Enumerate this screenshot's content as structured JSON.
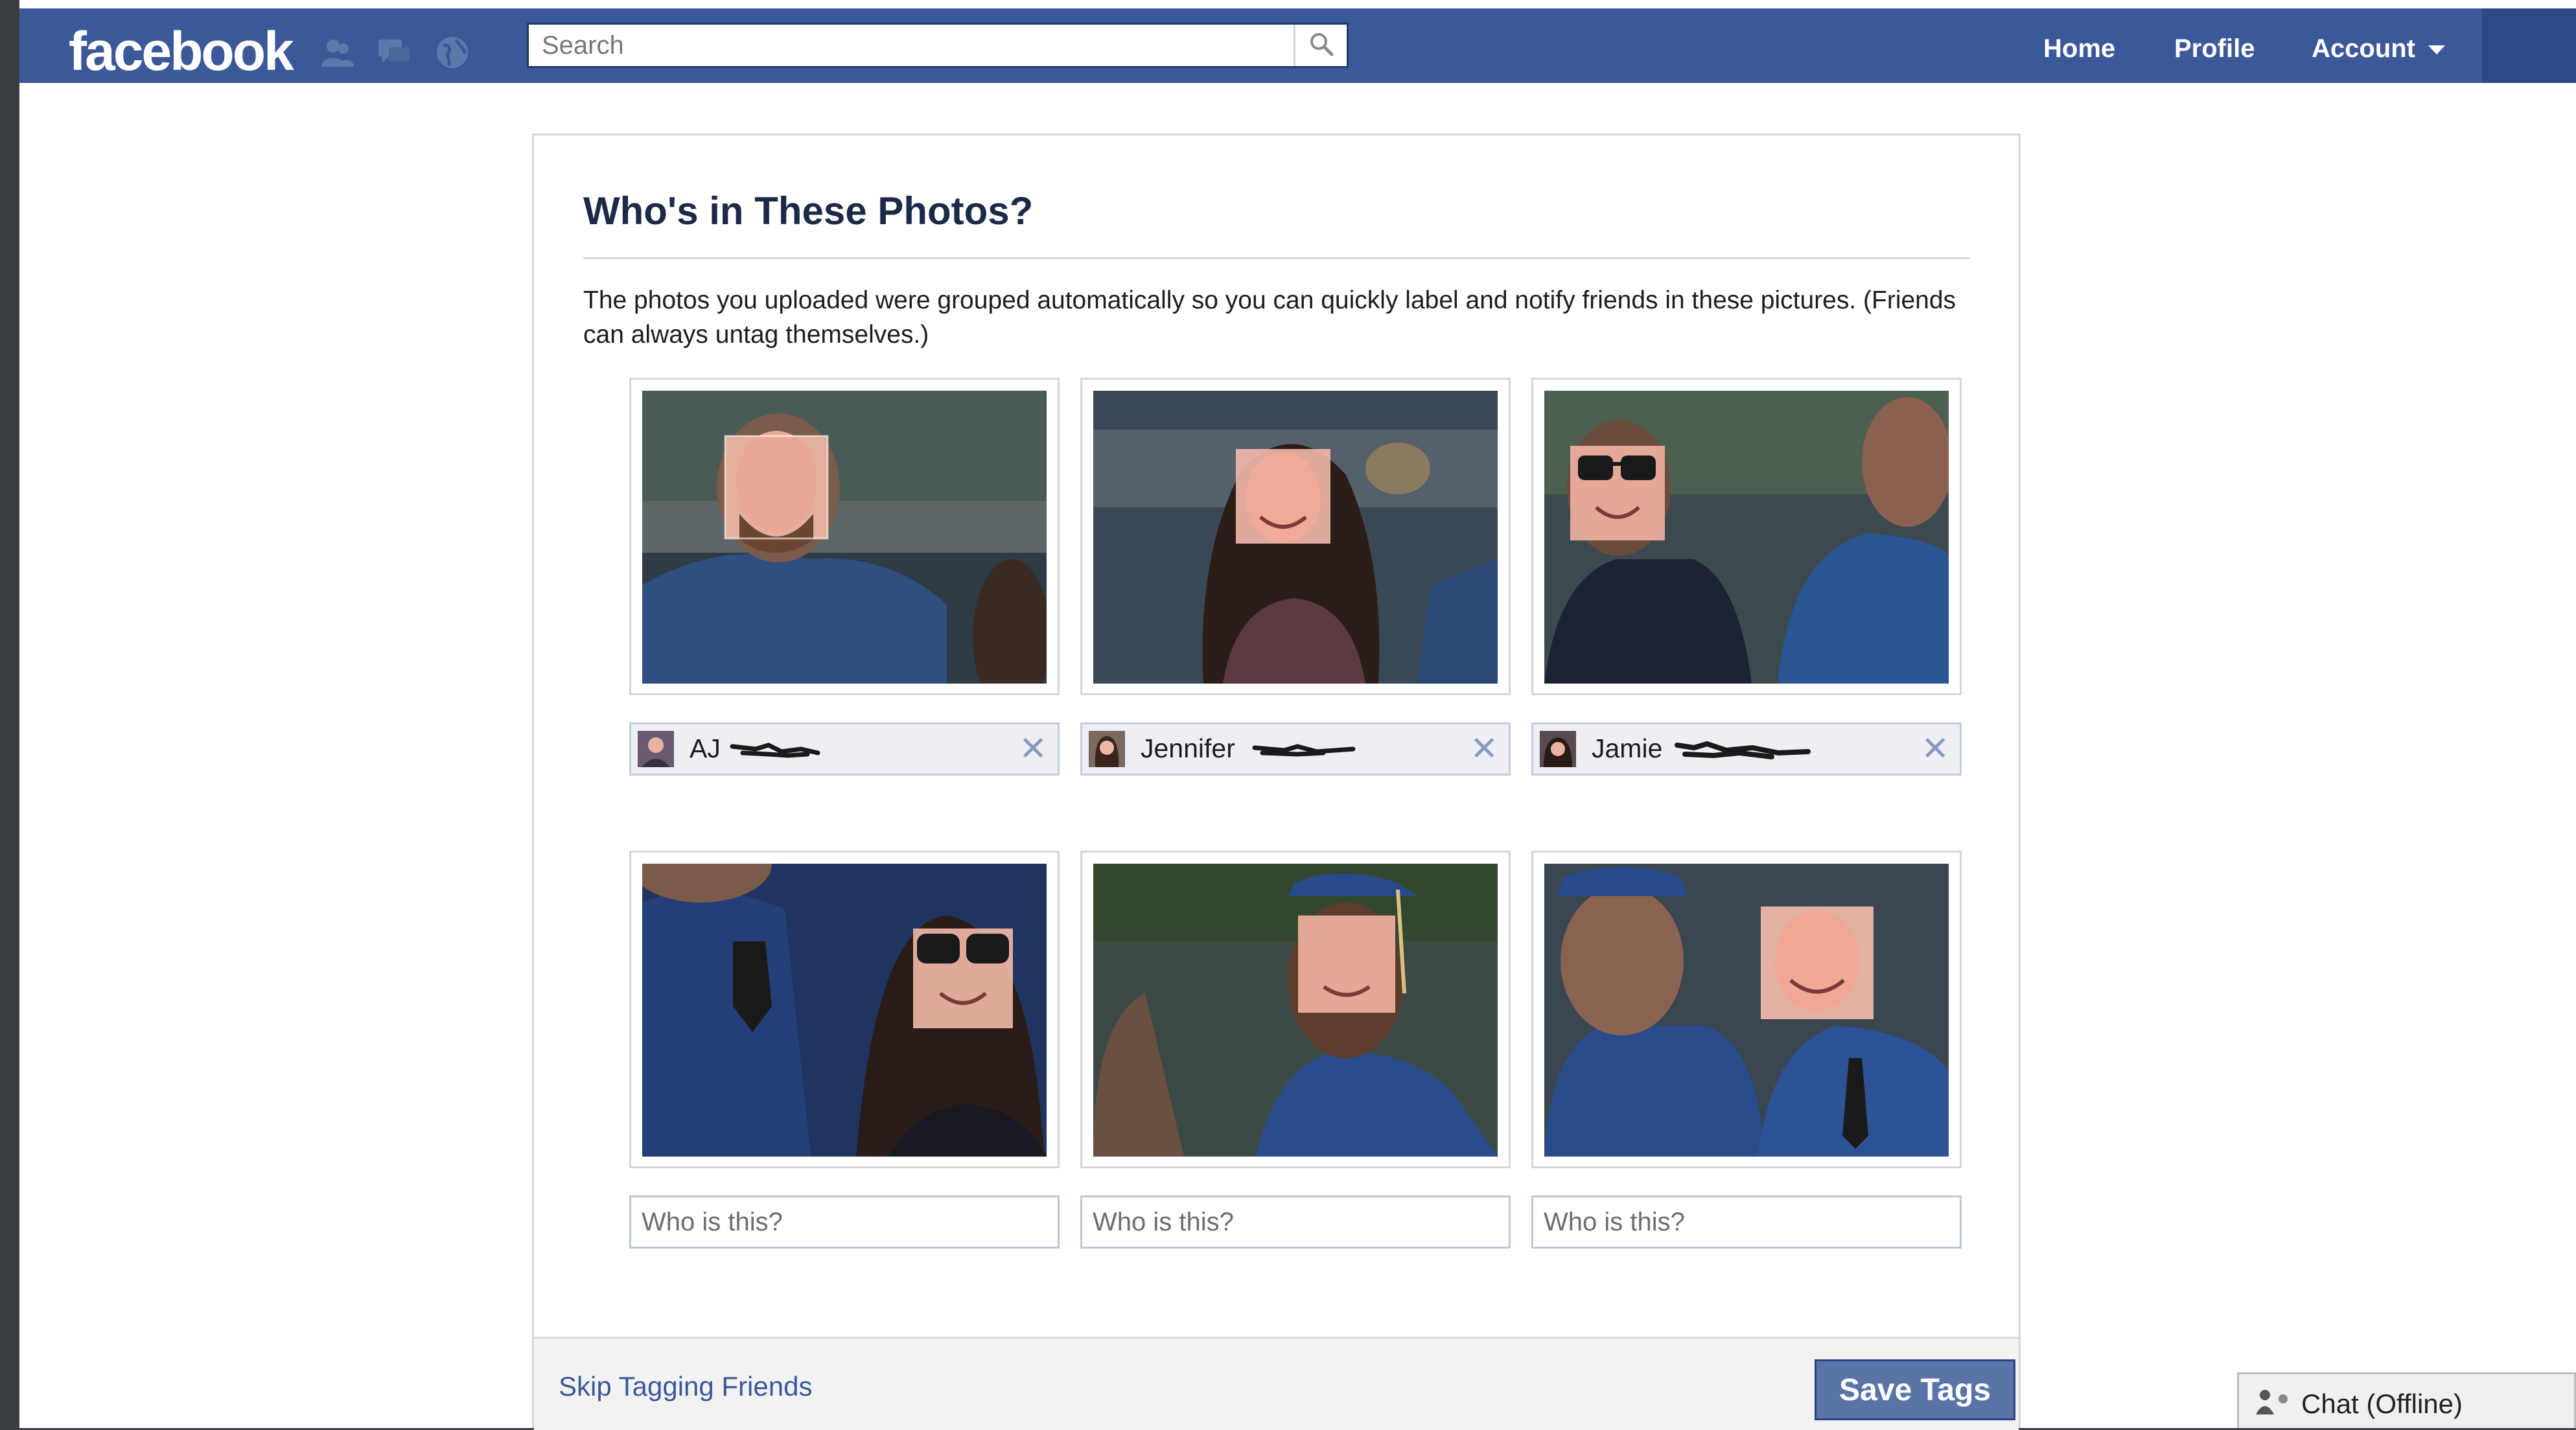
{
  "header": {
    "logo_text": "facebook",
    "jewels": [
      "friends-icon",
      "messages-icon",
      "notifications-icon"
    ],
    "search_placeholder": "Search",
    "nav": {
      "home": "Home",
      "profile": "Profile",
      "account": "Account"
    }
  },
  "dialog": {
    "title": "Who's in These Photos?",
    "description": "The photos you uploaded were grouped automatically so you can quickly label and notify friends in these pictures. (Friends can always untag themselves.)",
    "tagged": [
      {
        "first_name": "AJ"
      },
      {
        "first_name": "Jennifer"
      },
      {
        "first_name": "Jamie"
      }
    ],
    "untagged_placeholder": "Who is this?",
    "skip_label": "Skip Tagging Friends",
    "save_label": "Save Tags"
  },
  "chat": {
    "label": "Chat (Offline)"
  },
  "colors": {
    "brand": "#3b5998",
    "tag_bg": "#edeff4",
    "save_button": "#5b74a8"
  }
}
